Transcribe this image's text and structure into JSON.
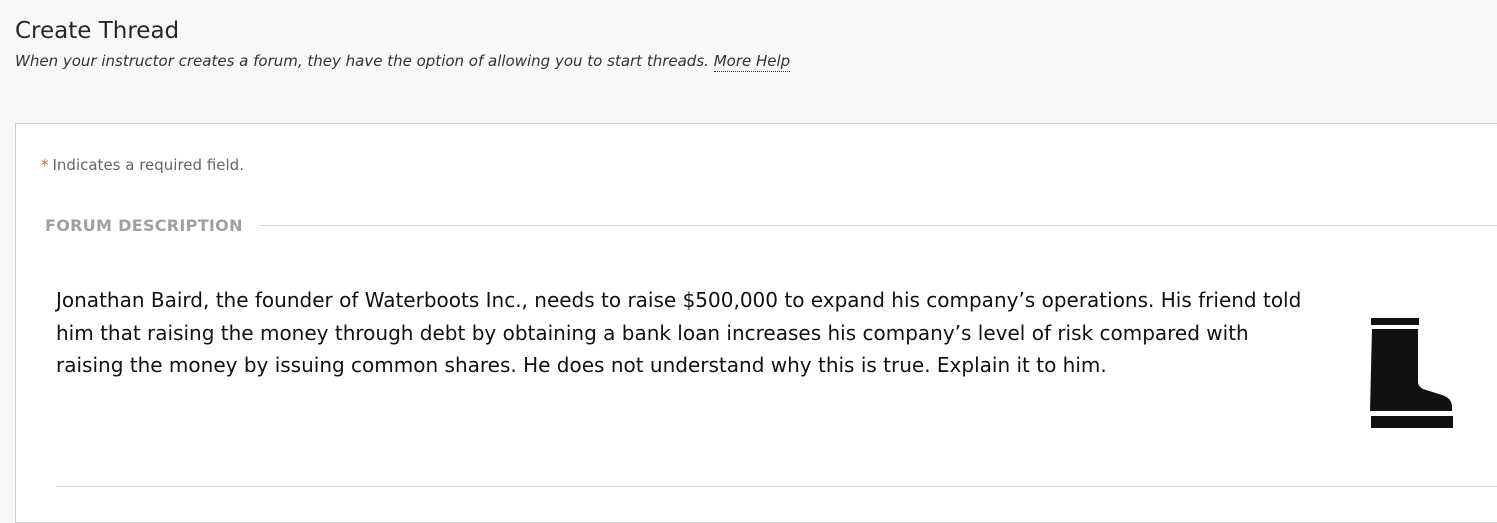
{
  "header": {
    "title": "Create Thread",
    "subtitle": "When your instructor creates a forum, they have the option of allowing you to start threads.",
    "more_help_label": "More Help"
  },
  "form": {
    "required_star": "*",
    "required_note": "Indicates a required field.",
    "section_title": "FORUM DESCRIPTION",
    "description": "Jonathan Baird, the founder of Waterboots Inc., needs to raise $500,000 to expand his company’s operations. His friend told him that raising the money through debt by obtaining a bank loan increases his company’s level of risk compared with raising the money by issuing common shares. He does not understand why this is true. Explain it to him.",
    "image_icon": "rubber-boot-icon"
  },
  "colors": {
    "page_background": "#f8f8f8",
    "panel_background": "#ffffff",
    "required_star": "#e0622a",
    "section_title": "#a0a0a0",
    "body_text": "#111111"
  }
}
